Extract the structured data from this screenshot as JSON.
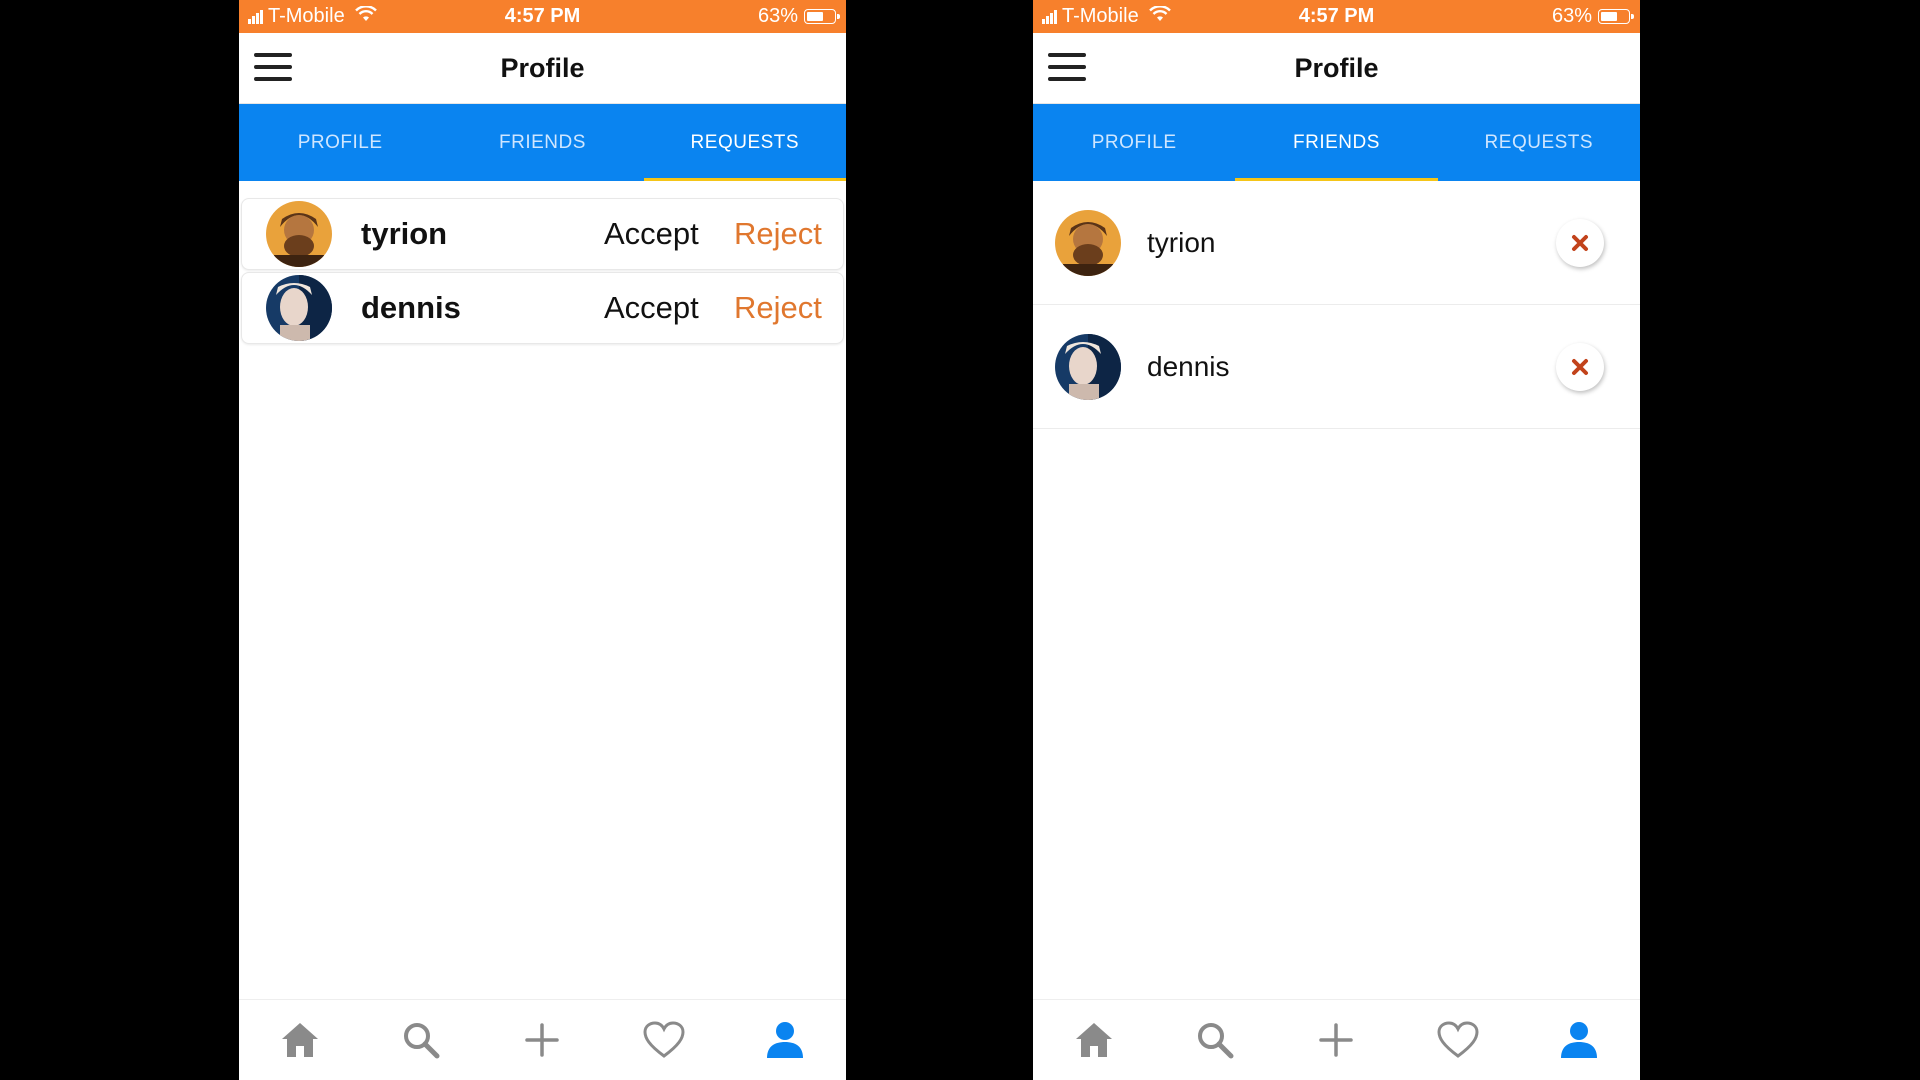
{
  "status_bar": {
    "carrier": "T-Mobile",
    "time": "4:57 PM",
    "battery": "63%",
    "battery_level": 0.63
  },
  "header": {
    "title": "Profile"
  },
  "tabs": [
    {
      "label": "PROFILE"
    },
    {
      "label": "FRIENDS"
    },
    {
      "label": "REQUESTS"
    }
  ],
  "left_screen": {
    "active_tab": "REQUESTS",
    "requests": [
      {
        "name": "tyrion",
        "accept_label": "Accept",
        "reject_label": "Reject"
      },
      {
        "name": "dennis",
        "accept_label": "Accept",
        "reject_label": "Reject"
      }
    ]
  },
  "right_screen": {
    "active_tab": "FRIENDS",
    "friends": [
      {
        "name": "tyrion",
        "remove_icon": "close-icon"
      },
      {
        "name": "dennis",
        "remove_icon": "close-icon"
      }
    ]
  },
  "bottom_nav": [
    {
      "icon": "home-icon"
    },
    {
      "icon": "search-icon"
    },
    {
      "icon": "plus-icon"
    },
    {
      "icon": "heart-icon"
    },
    {
      "icon": "user-icon",
      "active": true
    }
  ],
  "colors": {
    "status_bar": "#f7802c",
    "tab_bar": "#0a84f0",
    "tab_indicator": "#f5c518",
    "reject": "#e0772e",
    "remove_x": "#c2431b",
    "nav_active": "#0a84f0",
    "nav_inactive": "#8a8a8a"
  }
}
